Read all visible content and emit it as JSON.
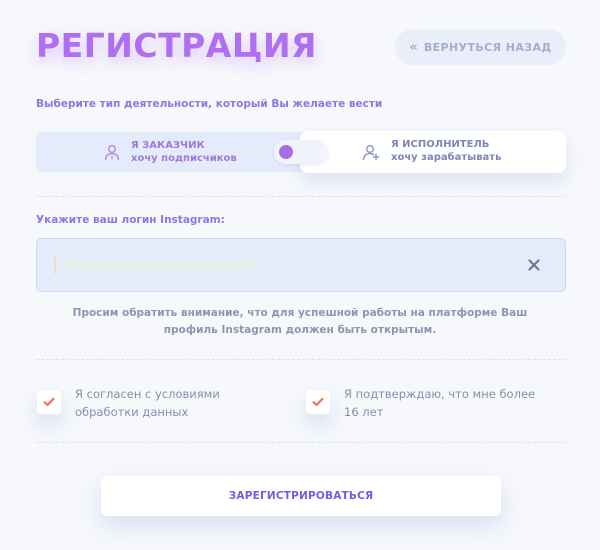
{
  "header": {
    "title": "РЕГИСТРАЦИЯ",
    "back_button_label": "ВЕРНУТЬСЯ НАЗАД"
  },
  "activity": {
    "label": "Выберите тип деятельности, который Вы желаете вести",
    "customer": {
      "title": "Я ЗАКАЗЧИК",
      "subtitle": "хочу подписчиков"
    },
    "performer": {
      "title": "Я ИСПОЛНИТЕЛЬ",
      "subtitle": "хочу зарабатывать"
    },
    "selected": "customer"
  },
  "login": {
    "label": "Укажите ваш логин Instagram:",
    "value": ""
  },
  "notice": "Просим обратить внимание, что для успешной работы на платформе Ваш профиль Instagram должен быть открытым.",
  "agreements": {
    "terms": {
      "label": "Я согласен с условиями обработки данных",
      "checked": true
    },
    "age": {
      "label": "Я подтверждаю, что мне более 16 лет",
      "checked": true
    }
  },
  "submit_label": "ЗАРЕГИСТРИРОВАТЬСЯ",
  "colors": {
    "accent": "#b06ef0",
    "check": "#ef6b52",
    "button_text": "#7a58e6"
  }
}
